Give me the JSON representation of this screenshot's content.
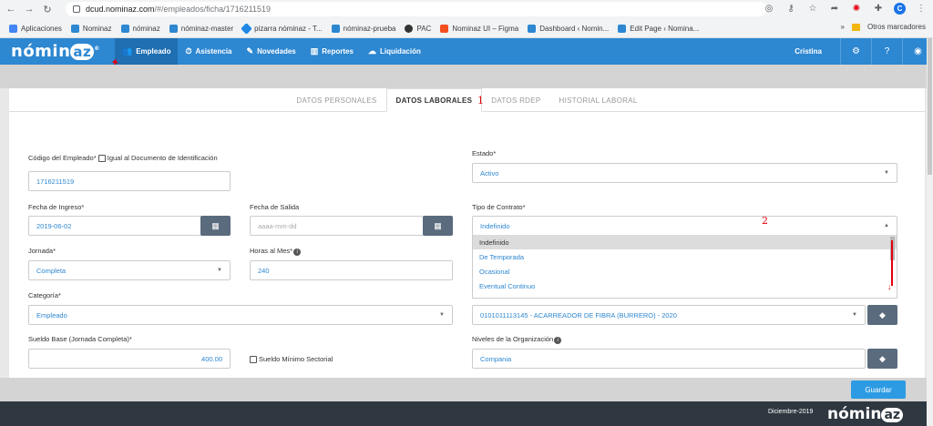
{
  "browser": {
    "url_host": "dcud.nominaz.com",
    "url_path": "/#/empleados/ficha/1716211519",
    "avatar_letter": "C",
    "bookmarks": [
      {
        "label": "Aplicaciones",
        "color": "#4285f4"
      },
      {
        "label": "Nominaz",
        "color": "#2d87d1"
      },
      {
        "label": "nóminaz",
        "color": "#2d87d1"
      },
      {
        "label": "nóminaz-master",
        "color": "#2d87d1"
      },
      {
        "label": "pizarra nóminaz - T...",
        "color": "#1e88e5"
      },
      {
        "label": "nóminaz-prueba",
        "color": "#2d87d1"
      },
      {
        "label": "PAC",
        "color": "#333333"
      },
      {
        "label": "Nominaz UI – Figma",
        "color": "#f24e1e"
      },
      {
        "label": "Dashboard ‹ Nomin...",
        "color": "#2d87d1"
      },
      {
        "label": "Edit Page ‹ Nomina...",
        "color": "#2d87d1"
      }
    ],
    "more_label": "»",
    "other_bookmarks": "Otros marcadores"
  },
  "app": {
    "logo_text": "nómin",
    "logo_az": "az",
    "logo_reg": "®",
    "menu": [
      {
        "label": "Empleado",
        "icon": "👥",
        "active": true
      },
      {
        "label": "Asistencia",
        "icon": "⏱"
      },
      {
        "label": "Novedades",
        "icon": "✎"
      },
      {
        "label": "Reportes",
        "icon": "📊"
      },
      {
        "label": "Liquidación",
        "icon": "☁"
      }
    ],
    "user": "Cristina"
  },
  "tabs": [
    "DATOS PERSONALES",
    "DATOS LABORALES",
    "DATOS RDEP",
    "HISTORIAL LABORAL"
  ],
  "annotations": {
    "one": "1",
    "two": "2"
  },
  "form": {
    "codigo_label": "Código del Empleado*",
    "igual_label": "Igual al Documento de Identificación",
    "codigo_value": "1716211519",
    "estado_label": "Estado*",
    "estado_value": "Activo",
    "fecha_ingreso_label": "Fecha de Ingreso*",
    "fecha_ingreso_value": "2019-06-02",
    "fecha_salida_label": "Fecha de Salida",
    "fecha_salida_placeholder": "aaaa-mm-dd",
    "tipo_contrato_label": "Tipo de Contrato*",
    "tipo_contrato_value": "Indefinido",
    "tipo_contrato_options": [
      "Indefinido",
      "De Temporada",
      "Ocasional",
      "Eventual Continuo"
    ],
    "jornada_label": "Jornada*",
    "jornada_value": "Completa",
    "horas_label": "Horas al Mes*",
    "horas_value": "240",
    "categoria_label": "Categoría*",
    "categoria_value": "Empleado",
    "cargo_value": "0101011113145 - ACARREADOR DE FIBRA (BURRERO) - 2020",
    "sueldo_label": "Sueldo Base (Jornada Completa)*",
    "sueldo_value": "400.00",
    "sueldo_minimo_label": "Sueldo Mínimo Sectorial",
    "niveles_label": "Niveles de la Organización",
    "niveles_value": "Compania"
  },
  "save_label": "Guardar",
  "footer": {
    "date": "Diciembre-2019",
    "logo_text": "nómin",
    "logo_az": "az"
  }
}
